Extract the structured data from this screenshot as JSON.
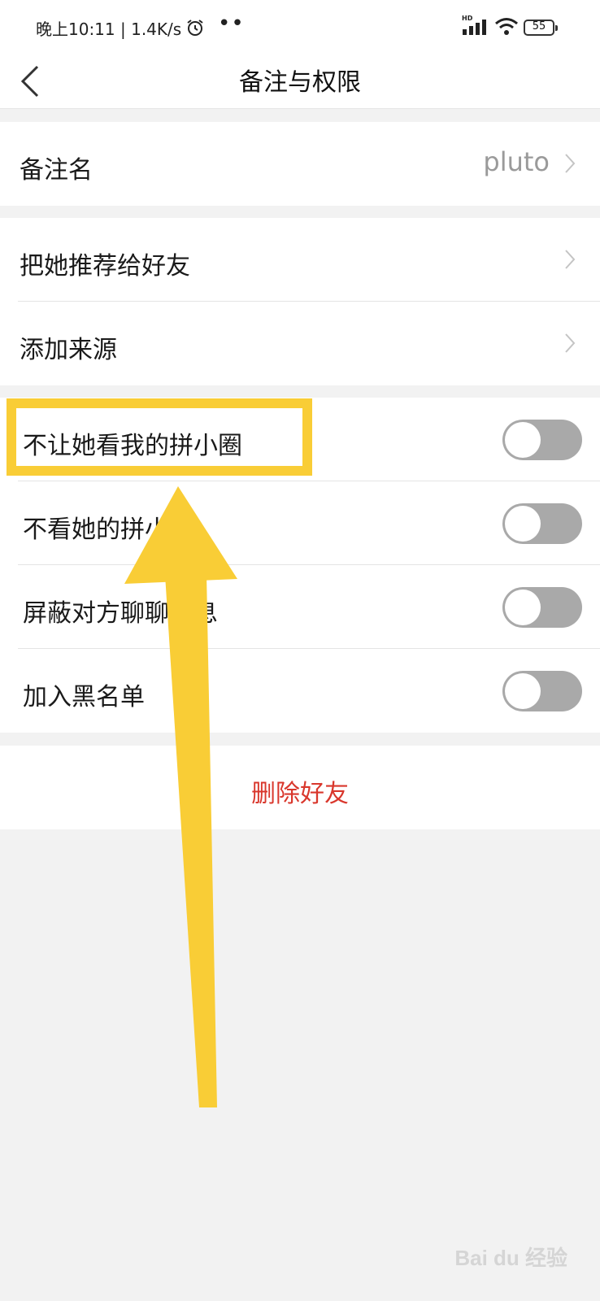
{
  "status_bar": {
    "left_text": "晚上10:11 | 1.4K/s",
    "dots": "••",
    "network_type": "HD",
    "battery": "55"
  },
  "nav": {
    "title": "备注与权限"
  },
  "remark": {
    "label": "备注名",
    "value": "pluto"
  },
  "group_links": {
    "items": [
      {
        "label": "把她推荐给好友"
      },
      {
        "label": "添加来源"
      }
    ]
  },
  "permissions": {
    "items": [
      {
        "label": "不让她看我的拼小圈",
        "enabled": false
      },
      {
        "label": "不看她的拼小圈",
        "enabled": false
      },
      {
        "label": "屏蔽对方聊聊消息",
        "enabled": false
      },
      {
        "label": "加入黑名单",
        "enabled": false
      }
    ]
  },
  "delete": {
    "label": "删除好友"
  },
  "annotation": {
    "highlight_color": "#f9cd36",
    "arrow_color": "#f9cd36"
  },
  "watermark": "Bai du 经验"
}
